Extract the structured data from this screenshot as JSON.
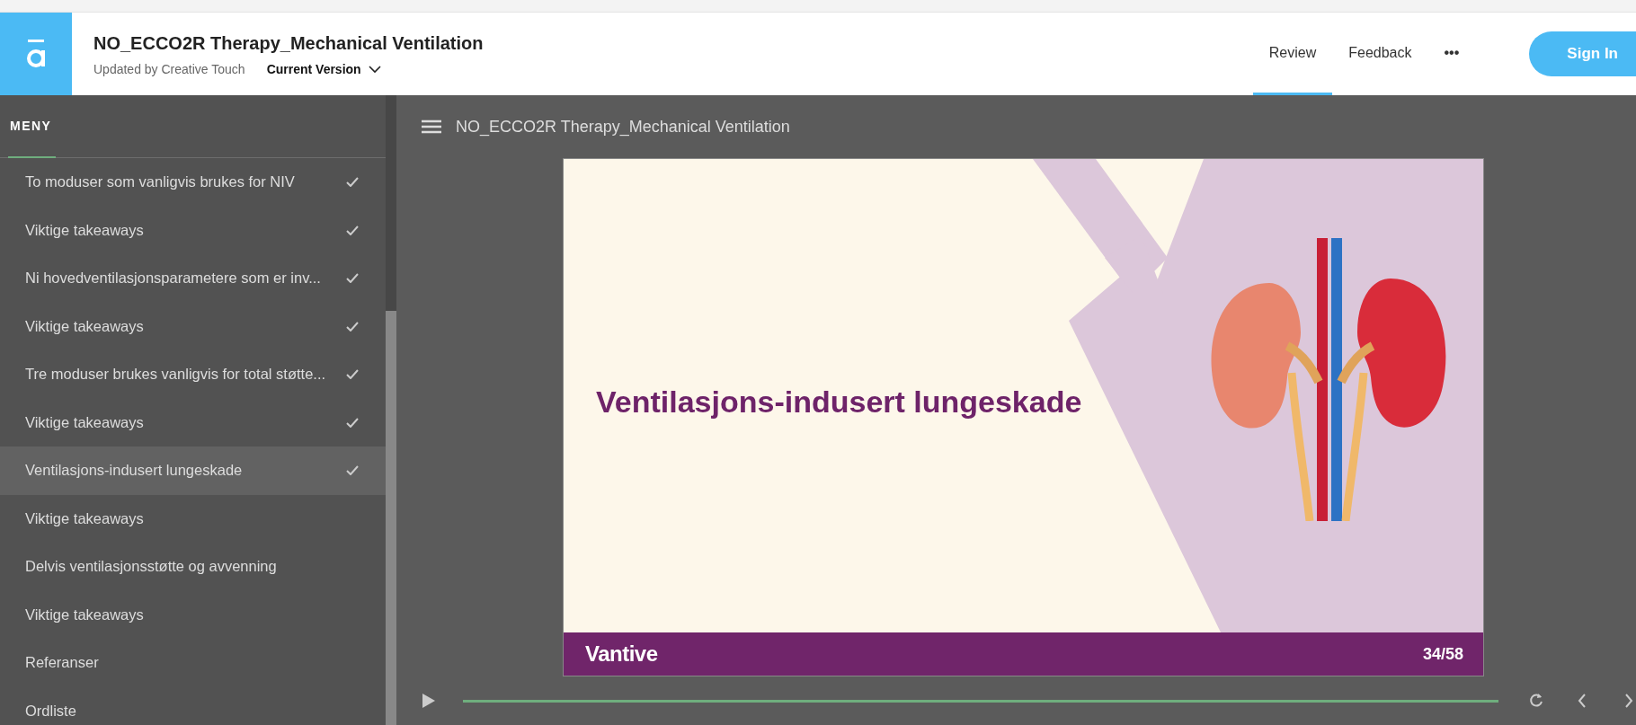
{
  "header": {
    "title": "NO_ECCO2R Therapy_Mechanical Ventilation",
    "subtitle": "Updated by Creative Touch",
    "version": "Current Version",
    "nav": [
      {
        "label": "Review",
        "selected": true
      },
      {
        "label": "Feedback",
        "selected": false
      }
    ],
    "more": "•••",
    "sign_in": "Sign In"
  },
  "sidebar": {
    "heading": "MENY",
    "items": [
      {
        "label": "To moduser som vanligvis brukes for NIV",
        "checked": true,
        "selected": false
      },
      {
        "label": "Viktige takeaways",
        "checked": true,
        "selected": false
      },
      {
        "label": "Ni hovedventilasjonsparametere som er inv...",
        "checked": true,
        "selected": false
      },
      {
        "label": "Viktige takeaways",
        "checked": true,
        "selected": false
      },
      {
        "label": "Tre moduser brukes vanligvis for total støtte...",
        "checked": true,
        "selected": false
      },
      {
        "label": "Viktige takeaways",
        "checked": true,
        "selected": false
      },
      {
        "label": "Ventilasjons-indusert lungeskade",
        "checked": true,
        "selected": true
      },
      {
        "label": "Viktige takeaways",
        "checked": false,
        "selected": false
      },
      {
        "label": "Delvis ventilasjonsstøtte og avvenning",
        "checked": false,
        "selected": false
      },
      {
        "label": "Viktige takeaways",
        "checked": false,
        "selected": false
      },
      {
        "label": "Referanser",
        "checked": false,
        "selected": false
      },
      {
        "label": "Ordliste",
        "checked": false,
        "selected": false
      }
    ]
  },
  "player": {
    "title": "NO_ECCO2R Therapy_Mechanical Ventilation",
    "slide": {
      "heading": "Ventilasjons-indusert lungeskade",
      "brand": "Vantive",
      "page": "34/58"
    },
    "progress": {
      "level": 1
    }
  }
}
